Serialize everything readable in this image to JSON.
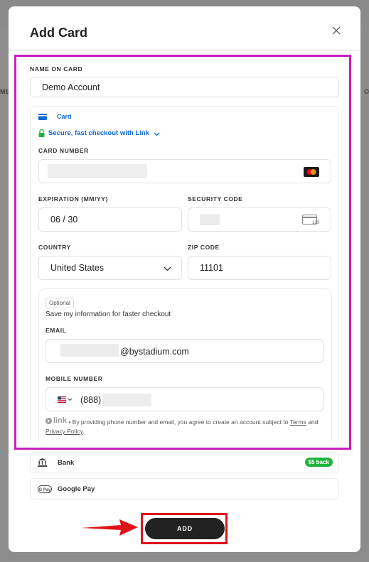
{
  "dialog": {
    "title": "Add Card",
    "close_icon": "close-icon"
  },
  "background": {
    "left_text": "ME",
    "right_text": "O"
  },
  "form": {
    "name_label": "NAME ON CARD",
    "name_value": "Demo Account",
    "payment_tab_label": "Card",
    "link_checkout_text": "Secure, fast checkout with Link",
    "card_number_label": "CARD NUMBER",
    "card_brand_icon": "mastercard-icon",
    "expiration_label": "EXPIRATION (MM/YY)",
    "expiration_value": "06 / 30",
    "security_code_label": "SECURITY CODE",
    "security_code_icon_text": "123",
    "country_label": "COUNTRY",
    "country_value": "United States",
    "zip_label": "ZIP CODE",
    "zip_value": "11101",
    "optional_label": "Optional",
    "save_info_text": "Save my information for faster checkout",
    "email_label": "EMAIL",
    "email_suffix": "@bystadium.com",
    "mobile_label": "MOBILE NUMBER",
    "mobile_prefix": "(888)",
    "link_logo_text": "link",
    "legal_text": " • By providing phone number and email, you agree to create an account subject to ",
    "terms_label": "Terms",
    "and_text": " and ",
    "privacy_label": "Privacy Policy",
    "period_text": "."
  },
  "methods": [
    {
      "label": "Bank",
      "icon": "bank-icon",
      "badge": "$5 back"
    },
    {
      "label": "Google Pay",
      "icon": "google-pay-icon"
    }
  ],
  "actions": {
    "add_label": "ADD"
  },
  "colors": {
    "highlight_magenta": "#c81ec0",
    "highlight_red": "#e0121a",
    "link_blue": "#0a66d8",
    "link_green": "#1fb33a"
  }
}
